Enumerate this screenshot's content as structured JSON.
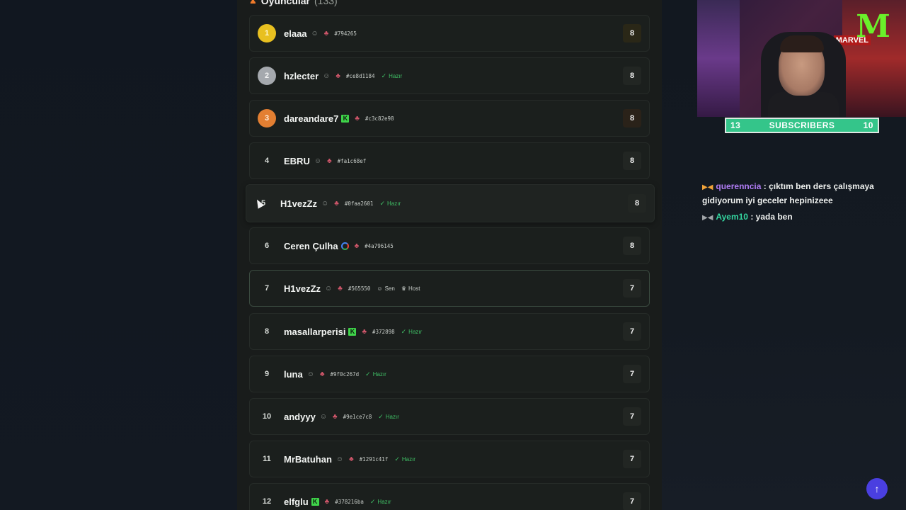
{
  "header": {
    "title": "Oyuncular",
    "count": "(133)"
  },
  "players": [
    {
      "rank": "1",
      "name": "elaaa",
      "hash": "#794265",
      "status": "",
      "score": "8",
      "medal": "gold",
      "platform": "user"
    },
    {
      "rank": "2",
      "name": "hzlecter",
      "hash": "#ce8d1184",
      "status": "Hazır",
      "score": "8",
      "medal": "silver",
      "platform": "user"
    },
    {
      "rank": "3",
      "name": "dareandare7",
      "hash": "#c3c82e98",
      "status": "",
      "score": "8",
      "medal": "bronze",
      "platform": "kick"
    },
    {
      "rank": "4",
      "name": "EBRU",
      "hash": "#fa1c68ef",
      "status": "",
      "score": "8",
      "medal": "plain",
      "platform": "user"
    },
    {
      "rank": "5",
      "name": "H1vezZz",
      "hash": "#0faa2601",
      "status": "Hazır",
      "score": "8",
      "medal": "plain",
      "platform": "user"
    },
    {
      "rank": "6",
      "name": "Ceren Çulha",
      "hash": "#4a796145",
      "status": "",
      "score": "8",
      "medal": "plain",
      "platform": "google"
    },
    {
      "rank": "7",
      "name": "H1vezZz",
      "hash": "#565550",
      "status": "",
      "score": "7",
      "medal": "plain",
      "platform": "user",
      "self_label": "Sen",
      "host_label": "Host"
    },
    {
      "rank": "8",
      "name": "masallarperisi",
      "hash": "#372898",
      "status": "Hazır",
      "score": "7",
      "medal": "plain",
      "platform": "kick"
    },
    {
      "rank": "9",
      "name": "luna",
      "hash": "#9f0c267d",
      "status": "Hazır",
      "score": "7",
      "medal": "plain",
      "platform": "user"
    },
    {
      "rank": "10",
      "name": "andyyy",
      "hash": "#9e1ce7c8",
      "status": "Hazır",
      "score": "7",
      "medal": "plain",
      "platform": "user"
    },
    {
      "rank": "11",
      "name": "MrBatuhan",
      "hash": "#1291c41f",
      "status": "Hazır",
      "score": "7",
      "medal": "plain",
      "platform": "user"
    },
    {
      "rank": "12",
      "name": "elfglu",
      "hash": "#378216ba",
      "status": "Hazır",
      "score": "7",
      "medal": "plain",
      "platform": "kick"
    }
  ],
  "stream": {
    "subscribers_left": "13",
    "subscribers_label": "SUBSCRIBERS",
    "subscribers_right": "10",
    "monster_logo": "M",
    "marvel_logo": "MARVEL"
  },
  "chat": [
    {
      "user": "querenncia",
      "text": ": çıktım ben ders çalışmaya gidiyorum iyi geceler hepinizeee"
    },
    {
      "user": "Ayem10",
      "text": ": yada ben"
    }
  ],
  "colors": {
    "accent_ready": "#3fbf65",
    "gold": "#e8c020",
    "bronze": "#e37f32",
    "scroll_button": "#4a3fe0",
    "sub_bar": "#34c58a"
  },
  "icons": {
    "scroll_top": "arrow-up-icon",
    "header": "users-icon"
  }
}
